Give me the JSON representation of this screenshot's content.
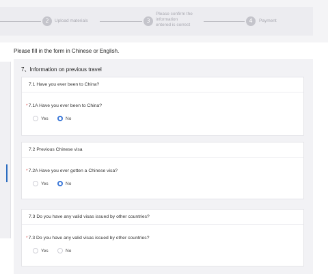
{
  "stepper": {
    "steps": [
      {
        "number": "2",
        "label": "Upload materials"
      },
      {
        "number": "3",
        "label_lines": [
          "Please confirm the",
          "information",
          "entered is correct"
        ]
      },
      {
        "number": "4",
        "label": "Payment"
      }
    ]
  },
  "instruction": "Please fill in the form in Chinese or English.",
  "section": {
    "title": "7、Information on previous travel",
    "cards": [
      {
        "heading": "7.1 Have you ever been to China?",
        "question_mark": "*",
        "question": "7.1A Have you ever been to China?",
        "options": [
          {
            "label": "Yes",
            "selected": false
          },
          {
            "label": "No",
            "selected": true
          }
        ]
      },
      {
        "heading": "7.2 Previous Chinese visa",
        "question_mark": "*",
        "question": "7.2A Have you ever gotten a Chinese visa?",
        "options": [
          {
            "label": "Yes",
            "selected": false
          },
          {
            "label": "No",
            "selected": true
          }
        ]
      },
      {
        "heading": "7.3 Do you have any valid visas issued by other countries?",
        "question_mark": "*",
        "question": "7.3 Do you have any valid visas issued by other countries?",
        "options": [
          {
            "label": "Yes",
            "selected": false
          },
          {
            "label": "No",
            "selected": false
          }
        ]
      }
    ]
  },
  "colors": {
    "accent": "#3b78d8",
    "required": "#e05a5a"
  }
}
